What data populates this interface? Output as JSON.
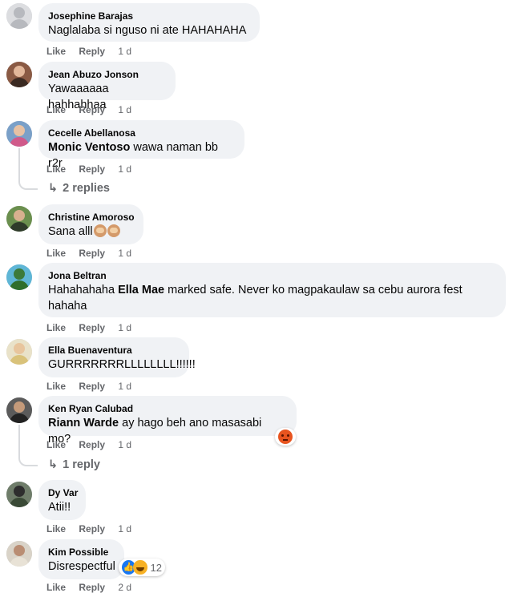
{
  "action_labels": {
    "like": "Like",
    "reply": "Reply"
  },
  "comments": [
    {
      "author": "Josephine Barajas",
      "text": "Naglalaba si nguso ni ate HAHAHAHA",
      "time": "1 d"
    },
    {
      "author": "Jean Abuzo Jonson",
      "text": "Yawaaaaaa hahhahhaa",
      "time": "1 d"
    },
    {
      "author": "Cecelle Abellanosa",
      "tag": "Monic Ventoso",
      "text": "wawa naman bb r2r",
      "time": "1 d",
      "replies": "2 replies"
    },
    {
      "author": "Christine Amoroso",
      "text": "Sana alll",
      "emoji": "see-no-evil-monkey-emoji",
      "time": "1 d"
    },
    {
      "author": "Jona Beltran",
      "text_pre": "Hahahahaha ",
      "tag": "Ella Mae",
      "text_post": " marked safe. Never ko magpakaulaw sa cebu aurora fest",
      "text_line2": "hahaha",
      "time": "1 d"
    },
    {
      "author": "Ella Buenaventura",
      "text": "GURRRRRRRLLLLLLLL!!!!!!",
      "time": "1 d"
    },
    {
      "author": "Ken Ryan Calubad",
      "tag": "Riann Warde",
      "text": "ay hago beh ano masasabi mo?",
      "time": "1 d",
      "replies": "1 reply",
      "reaction": "angry-reaction"
    },
    {
      "author": "Dy Var",
      "text": "Atii!!",
      "time": "1 d"
    },
    {
      "author": "Kim Possible",
      "text": "Disrespectful",
      "time": "2 d",
      "reaction_count": "12",
      "reaction": "like-haha-reactions"
    }
  ],
  "colors": {
    "bubble": "#f0f2f5",
    "secondary_text": "#65676b",
    "like_blue": "#1877f2"
  }
}
